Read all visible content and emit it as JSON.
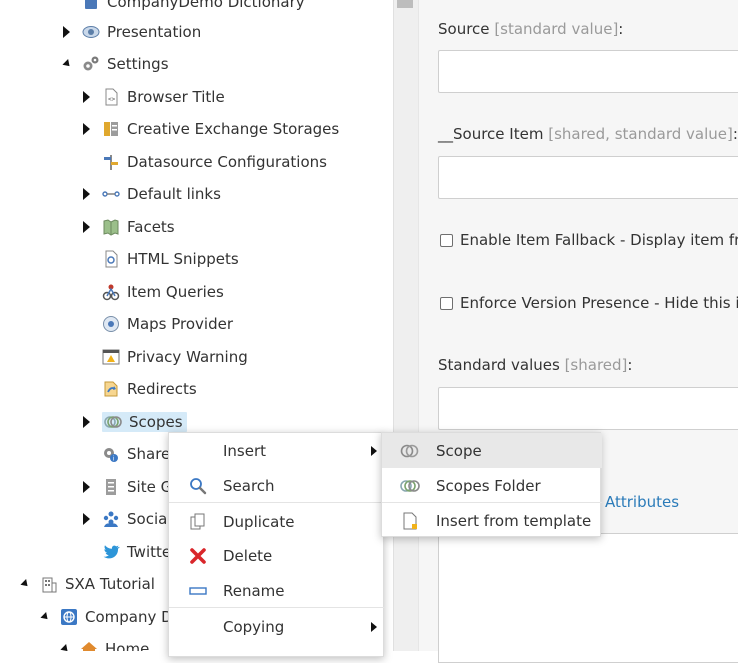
{
  "tree": {
    "items": [
      {
        "label": "CompanyDemo Dictionary",
        "icon": "dictionary-icon",
        "expander": "none"
      },
      {
        "label": "Presentation",
        "icon": "eye-icon",
        "expander": "collapsed"
      },
      {
        "label": "Settings",
        "icon": "gears-icon",
        "expander": "expanded"
      },
      {
        "label": "Browser Title",
        "icon": "browser-title-icon",
        "expander": "collapsed"
      },
      {
        "label": "Creative Exchange Storages",
        "icon": "storage-icon",
        "expander": "collapsed"
      },
      {
        "label": "Datasource Configurations",
        "icon": "signpost-icon",
        "expander": "none"
      },
      {
        "label": "Default links",
        "icon": "links-icon",
        "expander": "collapsed"
      },
      {
        "label": "Facets",
        "icon": "facets-icon",
        "expander": "collapsed"
      },
      {
        "label": "HTML Snippets",
        "icon": "html-snippet-icon",
        "expander": "none"
      },
      {
        "label": "Item Queries",
        "icon": "item-queries-icon",
        "expander": "none"
      },
      {
        "label": "Maps Provider",
        "icon": "maps-icon",
        "expander": "none"
      },
      {
        "label": "Privacy Warning",
        "icon": "warning-icon",
        "expander": "none"
      },
      {
        "label": "Redirects",
        "icon": "redirect-icon",
        "expander": "none"
      },
      {
        "label": "Scopes",
        "icon": "scopes-icon",
        "expander": "collapsed"
      },
      {
        "label": "Shared",
        "icon": "shared-icon",
        "expander": "none"
      },
      {
        "label": "Site Gr",
        "icon": "site-grouping-icon",
        "expander": "collapsed"
      },
      {
        "label": "Social",
        "icon": "social-icon",
        "expander": "collapsed"
      },
      {
        "label": "Twitte",
        "icon": "twitter-icon",
        "expander": "none"
      },
      {
        "label": "SXA Tutorial",
        "icon": "building-icon",
        "expander": "expanded"
      },
      {
        "label": "Company Dl",
        "icon": "globe-icon",
        "expander": "expanded"
      },
      {
        "label": "Home",
        "icon": "home-icon",
        "expander": "expanded"
      }
    ]
  },
  "fields": {
    "source_label": "Source",
    "source_meta": "[standard value]",
    "source_colon": ":",
    "source_item_label": "__Source Item",
    "source_item_meta": "[shared, standard value]",
    "source_item_colon": ":",
    "fallback_label": "Enable Item Fallback - Display item from",
    "version_label": "Enforce Version Presence - Hide this iter",
    "standard_values_label": "Standard values",
    "standard_values_meta": "[shared]",
    "standard_values_colon": ":",
    "attributes_link": "Attributes"
  },
  "context_menu": {
    "items": [
      {
        "label": "Insert",
        "icon": "",
        "submenu": true
      },
      {
        "label": "Search",
        "icon": "search-icon",
        "submenu": false
      },
      {
        "label": "Duplicate",
        "icon": "duplicate-icon",
        "submenu": false
      },
      {
        "label": "Delete",
        "icon": "delete-icon",
        "submenu": false
      },
      {
        "label": "Rename",
        "icon": "rename-icon",
        "submenu": false
      },
      {
        "label": "Copying",
        "icon": "",
        "submenu": true
      }
    ]
  },
  "insert_submenu": {
    "items": [
      {
        "label": "Scope",
        "icon": "scope-icon"
      },
      {
        "label": "Scopes Folder",
        "icon": "scopes-folder-icon"
      },
      {
        "label": "Insert from template",
        "icon": "template-icon"
      }
    ]
  },
  "colors": {
    "selection": "#d5eaf8",
    "link": "#2b7bb9",
    "delete_red": "#d9262b",
    "search_blue": "#3b78c4"
  }
}
